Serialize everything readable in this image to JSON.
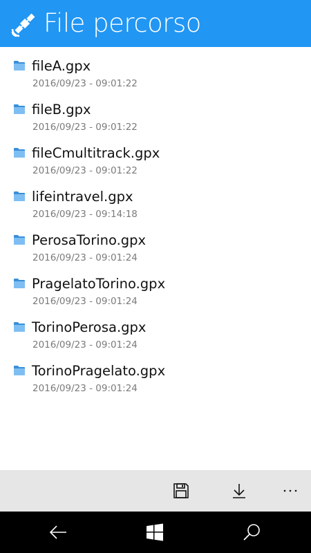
{
  "header": {
    "title": "File percorso",
    "icon": "satellite-icon",
    "background_color": "#2196f3"
  },
  "files": [
    {
      "name": "fileA.gpx",
      "date": "2016/09/23 - 09:01:22"
    },
    {
      "name": "fileB.gpx",
      "date": "2016/09/23 - 09:01:22"
    },
    {
      "name": "fileCmultitrack.gpx",
      "date": "2016/09/23 - 09:01:22"
    },
    {
      "name": "lifeintravel.gpx",
      "date": "2016/09/23 - 09:14:18"
    },
    {
      "name": "PerosaTorino.gpx",
      "date": "2016/09/23 - 09:01:24"
    },
    {
      "name": "PragelatoTorino.gpx",
      "date": "2016/09/23 - 09:01:24"
    },
    {
      "name": "TorinoPerosa.gpx",
      "date": "2016/09/23 - 09:01:24"
    },
    {
      "name": "TorinoPragelato.gpx",
      "date": "2016/09/23 - 09:01:24"
    }
  ],
  "file_icon": "folder-icon",
  "appbar": {
    "buttons": [
      "save-icon",
      "download-icon",
      "more-icon"
    ],
    "more_label": "...",
    "background_color": "#e6e6e6"
  },
  "navbar": {
    "buttons": [
      "back-arrow-icon",
      "windows-logo-icon",
      "search-icon"
    ]
  }
}
